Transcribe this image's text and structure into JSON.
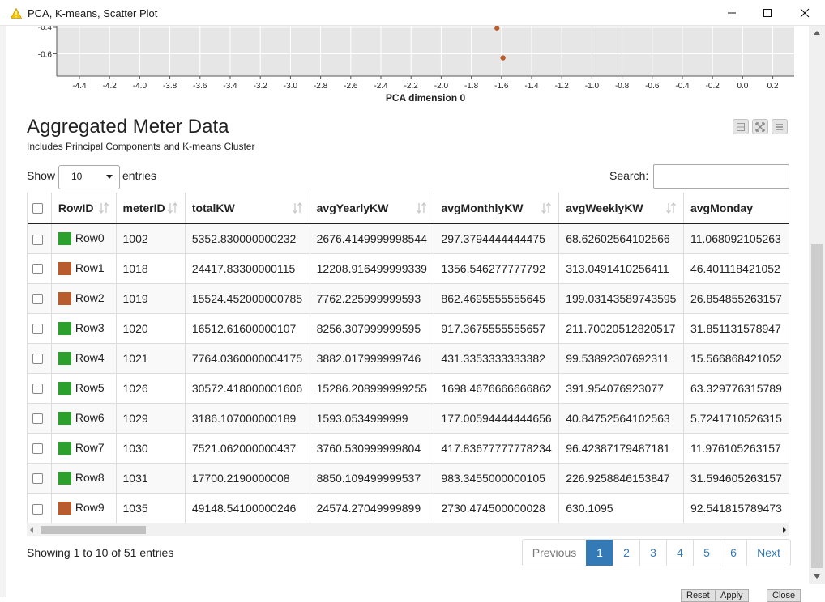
{
  "window": {
    "title": "PCA, K-means, Scatter Plot",
    "title_icon": "warning-icon"
  },
  "plot": {
    "y_ticks": [
      "-0.4",
      "-0.6"
    ],
    "x_ticks": [
      "-4.4",
      "-4.2",
      "-4.0",
      "-3.8",
      "-3.6",
      "-3.4",
      "-3.2",
      "-3.0",
      "-2.8",
      "-2.6",
      "-2.4",
      "-2.2",
      "-2.0",
      "-1.8",
      "-1.6",
      "-1.4",
      "-1.2",
      "-1.0",
      "-0.8",
      "-0.6",
      "-0.4",
      "-0.2",
      "0.0",
      "0.2"
    ],
    "x_label": "PCA dimension 0",
    "point_color": "#b85c2e",
    "points": [
      {
        "x": -1.63,
        "y": -0.41
      },
      {
        "x": -1.59,
        "y": -0.63
      }
    ]
  },
  "header": {
    "title": "Aggregated Meter Data",
    "subtitle": "Includes Principal Components and K-means Cluster",
    "tool_icons": [
      "collapse-icon",
      "fullscreen-icon",
      "menu-icon"
    ]
  },
  "controls": {
    "show_label": "Show",
    "entries_value": "10",
    "entries_label": "entries",
    "search_label": "Search:",
    "search_value": ""
  },
  "table": {
    "columns": [
      "RowID",
      "meterID",
      "totalKW",
      "avgYearlyKW",
      "avgMonthlyKW",
      "avgWeeklyKW",
      "avgMonday"
    ],
    "cluster_colors": {
      "green": "#2ca02c",
      "orange": "#b85c2e"
    },
    "rows": [
      {
        "rowid": "Row0",
        "color": "#2ca02c",
        "meterID": "1002",
        "totalKW": "5352.830000000232",
        "avgYearlyKW": "2676.4149999998544",
        "avgMonthlyKW": "297.3794444444475",
        "avgWeeklyKW": "68.62602564102566",
        "avgMonday": "11.068092105263"
      },
      {
        "rowid": "Row1",
        "color": "#b85c2e",
        "meterID": "1018",
        "totalKW": "24417.83300000115",
        "avgYearlyKW": "12208.916499999339",
        "avgMonthlyKW": "1356.546277777792",
        "avgWeeklyKW": "313.0491410256411",
        "avgMonday": "46.401118421052"
      },
      {
        "rowid": "Row2",
        "color": "#b85c2e",
        "meterID": "1019",
        "totalKW": "15524.452000000785",
        "avgYearlyKW": "7762.225999999593",
        "avgMonthlyKW": "862.4695555555645",
        "avgWeeklyKW": "199.03143589743595",
        "avgMonday": "26.854855263157"
      },
      {
        "rowid": "Row3",
        "color": "#2ca02c",
        "meterID": "1020",
        "totalKW": "16512.61600000107",
        "avgYearlyKW": "8256.307999999595",
        "avgMonthlyKW": "917.3675555555657",
        "avgWeeklyKW": "211.70020512820517",
        "avgMonday": "31.851131578947"
      },
      {
        "rowid": "Row4",
        "color": "#2ca02c",
        "meterID": "1021",
        "totalKW": "7764.0360000004175",
        "avgYearlyKW": "3882.017999999746",
        "avgMonthlyKW": "431.3353333333382",
        "avgWeeklyKW": "99.53892307692311",
        "avgMonday": "15.566868421052"
      },
      {
        "rowid": "Row5",
        "color": "#2ca02c",
        "meterID": "1026",
        "totalKW": "30572.418000001606",
        "avgYearlyKW": "15286.208999999255",
        "avgMonthlyKW": "1698.4676666666862",
        "avgWeeklyKW": "391.954076923077",
        "avgMonday": "63.329776315789"
      },
      {
        "rowid": "Row6",
        "color": "#2ca02c",
        "meterID": "1029",
        "totalKW": "3186.107000000189",
        "avgYearlyKW": "1593.0534999999",
        "avgMonthlyKW": "177.00594444444656",
        "avgWeeklyKW": "40.84752564102563",
        "avgMonday": "5.7241710526315"
      },
      {
        "rowid": "Row7",
        "color": "#2ca02c",
        "meterID": "1030",
        "totalKW": "7521.062000000437",
        "avgYearlyKW": "3760.530999999804",
        "avgMonthlyKW": "417.83677777778234",
        "avgWeeklyKW": "96.42387179487181",
        "avgMonday": "11.976105263157"
      },
      {
        "rowid": "Row8",
        "color": "#2ca02c",
        "meterID": "1031",
        "totalKW": "17700.2190000008",
        "avgYearlyKW": "8850.109499999537",
        "avgMonthlyKW": "983.3455000000105",
        "avgWeeklyKW": "226.9258846153847",
        "avgMonday": "31.594605263157"
      },
      {
        "rowid": "Row9",
        "color": "#b85c2e",
        "meterID": "1035",
        "totalKW": "49148.54100000246",
        "avgYearlyKW": "24574.27049999899",
        "avgMonthlyKW": "2730.474500000028",
        "avgWeeklyKW": "630.1095",
        "avgMonday": "92.541815789473"
      }
    ]
  },
  "footer": {
    "info": "Showing 1 to 10 of 51 entries",
    "previous": "Previous",
    "next": "Next",
    "pages": [
      "1",
      "2",
      "3",
      "4",
      "5",
      "6"
    ],
    "active_page": "1"
  },
  "bottom_buttons": [
    "Reset",
    "Apply",
    "Close"
  ]
}
